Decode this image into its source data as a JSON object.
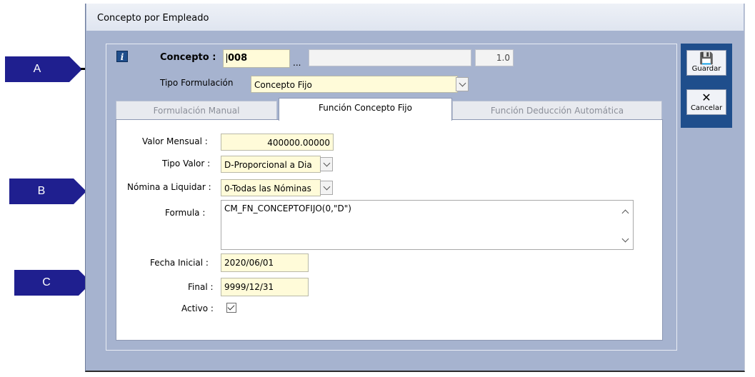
{
  "window": {
    "title": "Concepto por Empleado"
  },
  "header": {
    "concepto_label": "Concepto :",
    "concepto_value": "008",
    "browse_label": "...",
    "description_value": "",
    "version_value": "1.0",
    "tipo_formulacion_label": "Tipo Formulación",
    "tipo_formulacion_value": "Concepto Fijo"
  },
  "tabs": [
    {
      "label": "Formulación Manual",
      "active": false
    },
    {
      "label": "Función Concepto Fijo",
      "active": true
    },
    {
      "label": "Función Deducción Automática",
      "active": false
    }
  ],
  "form": {
    "valor_mensual_label": "Valor Mensual :",
    "valor_mensual_value": "400000.00000",
    "tipo_valor_label": "Tipo Valor :",
    "tipo_valor_value": "D-Proporcional a Dia",
    "nomina_label": "Nómina a Liquidar :",
    "nomina_value": "0-Todas las Nóminas",
    "formula_label": "Formula :",
    "formula_value": "CM_FN_CONCEPTOFIJO(0,\"D\")",
    "fecha_inicial_label": "Fecha Inicial :",
    "fecha_inicial_value": "2020/06/01",
    "final_label": "Final :",
    "final_value": "9999/12/31",
    "activo_label": "Activo :",
    "activo_checked": true
  },
  "toolbar": {
    "save_label": "Guardar",
    "cancel_label": "Cancelar"
  },
  "callouts": {
    "a": "A",
    "b": "B",
    "c": "C"
  },
  "colors": {
    "callout": "#1f1f8f",
    "window_bg": "#a6b3cf",
    "input_bg": "#fffbd9",
    "side_bar": "#1f4e8c"
  },
  "icons": {
    "info": "info-icon",
    "save": "floppy-disk-icon",
    "cancel": "close-x-icon"
  }
}
